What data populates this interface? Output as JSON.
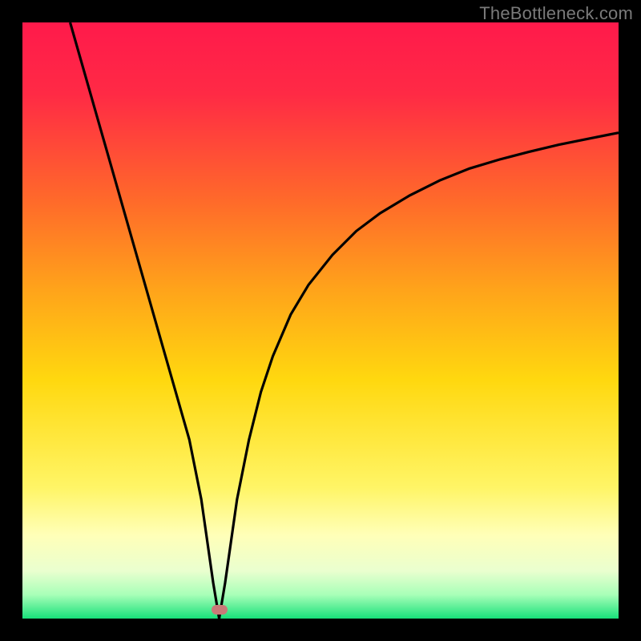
{
  "watermark": {
    "text": "TheBottleneck.com"
  },
  "colors": {
    "frame_bg": "#000000",
    "curve_stroke": "#000000",
    "marker_fill": "#c87a78"
  },
  "chart_data": {
    "type": "line",
    "title": "",
    "xlabel": "",
    "ylabel": "",
    "xlim": [
      0,
      100
    ],
    "ylim": [
      0,
      100
    ],
    "grid": false,
    "legend": false,
    "background_gradient": {
      "direction": "vertical",
      "stops": [
        {
          "y_value": 100,
          "color": "#ff1a4b"
        },
        {
          "y_value": 88,
          "color": "#ff2a45"
        },
        {
          "y_value": 70,
          "color": "#ff6a2a"
        },
        {
          "y_value": 55,
          "color": "#ffa41a"
        },
        {
          "y_value": 40,
          "color": "#ffd80f"
        },
        {
          "y_value": 22,
          "color": "#fff566"
        },
        {
          "y_value": 14,
          "color": "#ffffb8"
        },
        {
          "y_value": 8,
          "color": "#eaffcf"
        },
        {
          "y_value": 4,
          "color": "#a8ffb8"
        },
        {
          "y_value": 0,
          "color": "#18e07a"
        }
      ]
    },
    "series": [
      {
        "name": "bottleneck-curve",
        "x": [
          8,
          10,
          12,
          14,
          16,
          18,
          20,
          22,
          24,
          26,
          28,
          30,
          31,
          32,
          33,
          34,
          35,
          36,
          38,
          40,
          42,
          45,
          48,
          52,
          56,
          60,
          65,
          70,
          75,
          80,
          85,
          90,
          95,
          100
        ],
        "y": [
          100,
          93,
          86,
          79,
          72,
          65,
          58,
          51,
          44,
          37,
          30,
          20,
          13,
          6,
          0,
          6,
          13,
          20,
          30,
          38,
          44,
          51,
          56,
          61,
          65,
          68,
          71,
          73.5,
          75.5,
          77,
          78.3,
          79.5,
          80.5,
          81.5
        ]
      }
    ],
    "marker": {
      "x": 33,
      "y": 1.5
    }
  }
}
